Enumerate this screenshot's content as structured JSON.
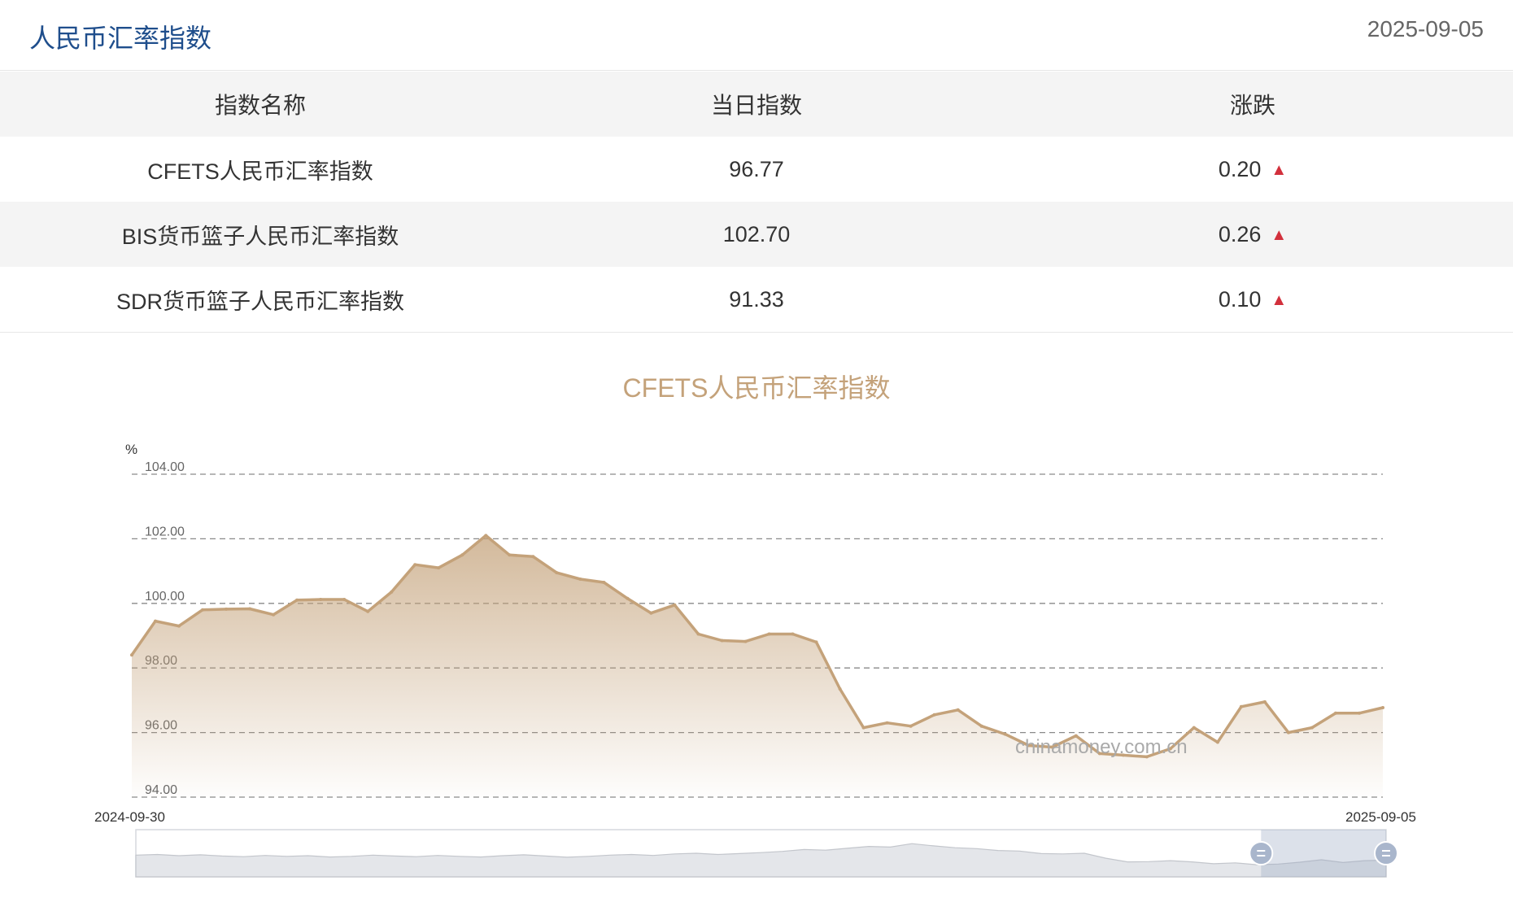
{
  "header": {
    "title": "人民币汇率指数",
    "date": "2025-09-05"
  },
  "table": {
    "columns": [
      "指数名称",
      "当日指数",
      "涨跌"
    ],
    "rows": [
      {
        "name": "CFETS人民币汇率指数",
        "value": "96.77",
        "change": "0.20",
        "direction": "up"
      },
      {
        "name": "BIS货币篮子人民币汇率指数",
        "value": "102.70",
        "change": "0.26",
        "direction": "up"
      },
      {
        "name": "SDR货币篮子人民币汇率指数",
        "value": "91.33",
        "change": "0.10",
        "direction": "up"
      }
    ],
    "up_symbol": "▲",
    "up_color": "#d2303c"
  },
  "chart_data": {
    "type": "area",
    "title": "CFETS人民币汇率指数",
    "y_unit": "%",
    "ylim": [
      94,
      104
    ],
    "y_ticks": [
      "94.00",
      "96.00",
      "98.00",
      "100.00",
      "102.00",
      "104.00"
    ],
    "x_start": "2024-09-30",
    "x_end": "2025-09-05",
    "grid": true,
    "values": [
      98.4,
      99.45,
      99.3,
      99.8,
      99.82,
      99.83,
      99.65,
      100.1,
      100.12,
      100.12,
      99.75,
      100.35,
      101.2,
      101.1,
      101.5,
      102.1,
      101.5,
      101.45,
      100.95,
      100.75,
      100.65,
      100.15,
      99.7,
      99.95,
      99.05,
      98.85,
      98.82,
      99.05,
      99.05,
      98.8,
      97.35,
      96.15,
      96.3,
      96.2,
      96.55,
      96.7,
      96.2,
      95.95,
      95.6,
      95.55,
      95.9,
      95.35,
      95.3,
      95.25,
      95.5,
      96.15,
      95.7,
      96.8,
      96.95,
      96.0,
      96.15,
      96.6,
      96.6,
      96.77
    ],
    "line_color": "#c4a27a",
    "watermark": "chinamoney.com.cn",
    "navigator": {
      "values": [
        98.4,
        98.6,
        98.2,
        98.5,
        98.1,
        97.9,
        98.3,
        98.0,
        98.2,
        97.8,
        98.0,
        98.4,
        98.1,
        97.9,
        98.3,
        98.0,
        97.8,
        98.2,
        98.5,
        98.1,
        97.7,
        98.0,
        98.4,
        98.6,
        98.3,
        98.8,
        99.0,
        98.6,
        98.9,
        99.2,
        99.6,
        100.2,
        100.0,
        100.6,
        101.2,
        101.0,
        102.1,
        101.4,
        100.8,
        100.5,
        99.9,
        99.7,
        98.9,
        98.8,
        99.0,
        97.4,
        96.2,
        96.3,
        96.6,
        96.2,
        95.6,
        95.9,
        95.3,
        95.5,
        96.1,
        96.9,
        96.0,
        96.6,
        96.77
      ],
      "range": [
        0.9,
        1.0
      ]
    }
  }
}
